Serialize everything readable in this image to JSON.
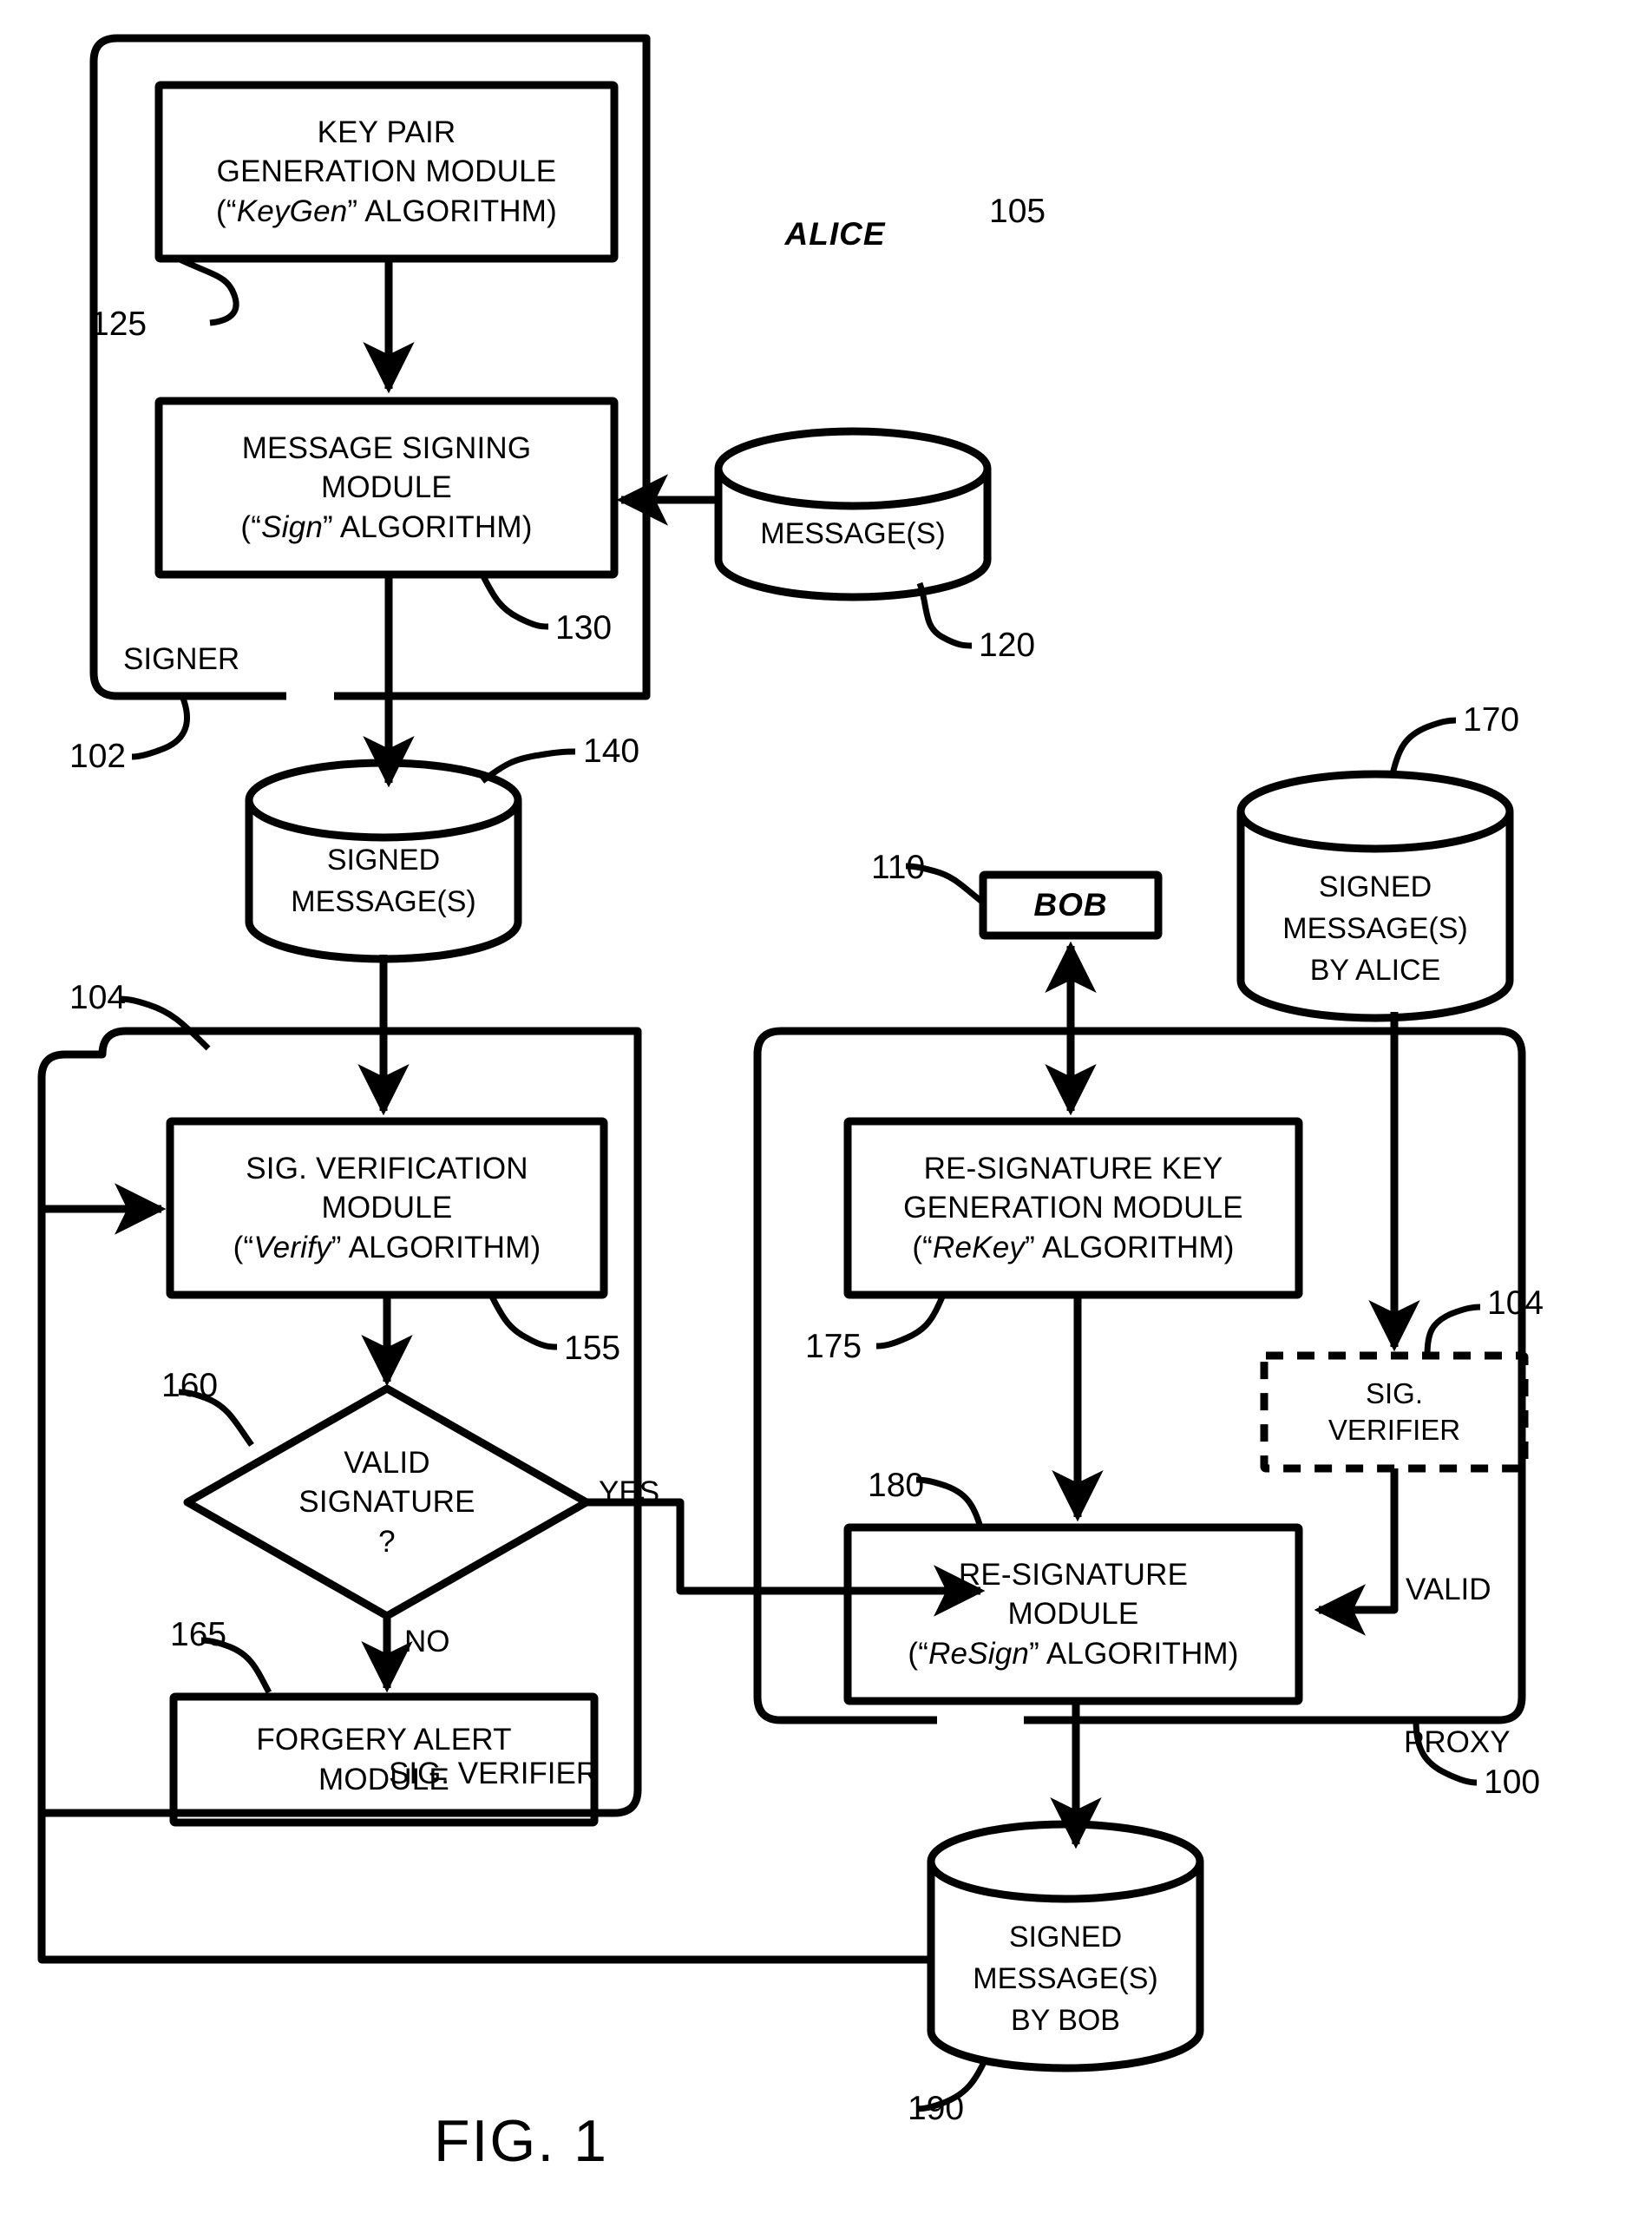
{
  "figure": {
    "caption": "FIG. 1",
    "system_ref": "100"
  },
  "entities": [
    {
      "name": "alice-entity",
      "label": "ALICE",
      "ref": "105"
    },
    {
      "name": "bob-entity",
      "label": "BOB",
      "ref": "110"
    }
  ],
  "groups": [
    {
      "name": "signer-group",
      "label": "SIGNER",
      "ref": "102"
    },
    {
      "name": "sig-verifier-group",
      "label": "SIG. VERIFIER",
      "ref": "104"
    },
    {
      "name": "proxy-group",
      "label": "PROXY",
      "ref": "100"
    }
  ],
  "modules": [
    {
      "name": "key-pair-generation-module",
      "ref": "125",
      "lines": [
        "KEY PAIR",
        "GENERATION MODULE"
      ],
      "algo_prefix": "(“",
      "algo_name": "KeyGen",
      "algo_suffix": "” ALGORITHM)"
    },
    {
      "name": "message-signing-module",
      "ref": "130",
      "lines": [
        "MESSAGE SIGNING",
        "MODULE"
      ],
      "algo_prefix": "(“",
      "algo_name": "Sign",
      "algo_suffix": "” ALGORITHM)"
    },
    {
      "name": "sig-verification-module",
      "ref": "155",
      "lines": [
        "SIG. VERIFICATION",
        "MODULE"
      ],
      "algo_prefix": "(“",
      "algo_name": "Verify",
      "algo_suffix": "” ALGORITHM)"
    },
    {
      "name": "forgery-alert-module",
      "ref": "165",
      "lines": [
        "FORGERY ALERT",
        "MODULE"
      ],
      "algo_prefix": "",
      "algo_name": "",
      "algo_suffix": ""
    },
    {
      "name": "re-signature-key-generation-module",
      "ref": "175",
      "lines": [
        "RE-SIGNATURE KEY",
        "GENERATION MODULE"
      ],
      "algo_prefix": "(“",
      "algo_name": "ReKey",
      "algo_suffix": "” ALGORITHM)"
    },
    {
      "name": "re-signature-module",
      "ref": "180",
      "lines": [
        "RE-SIGNATURE",
        "MODULE"
      ],
      "algo_prefix": "(“",
      "algo_name": "ReSign",
      "algo_suffix": "” ALGORITHM)"
    }
  ],
  "datastores": [
    {
      "name": "messages-store",
      "ref": "120",
      "lines": [
        "MESSAGE(S)"
      ]
    },
    {
      "name": "signed-messages-store",
      "ref": "140",
      "lines": [
        "SIGNED",
        "MESSAGE(S)"
      ]
    },
    {
      "name": "signed-messages-by-alice-store",
      "ref": "170",
      "lines": [
        "SIGNED",
        "MESSAGE(S)",
        "BY ALICE"
      ]
    },
    {
      "name": "signed-messages-by-bob-store",
      "ref": "190",
      "lines": [
        "SIGNED",
        "MESSAGE(S)",
        "BY BOB"
      ]
    }
  ],
  "decision": {
    "name": "valid-signature-decision",
    "ref": "160",
    "lines": [
      "VALID",
      "SIGNATURE",
      "?"
    ],
    "branch_yes": "YES",
    "branch_no": "NO"
  },
  "dashed_block": {
    "name": "proxy-sig-verifier",
    "ref": "104",
    "lines": [
      "SIG.",
      "VERIFIER"
    ]
  },
  "edge_labels": {
    "valid": "VALID"
  },
  "colors": {
    "stroke": "#000000",
    "background": "#ffffff"
  }
}
